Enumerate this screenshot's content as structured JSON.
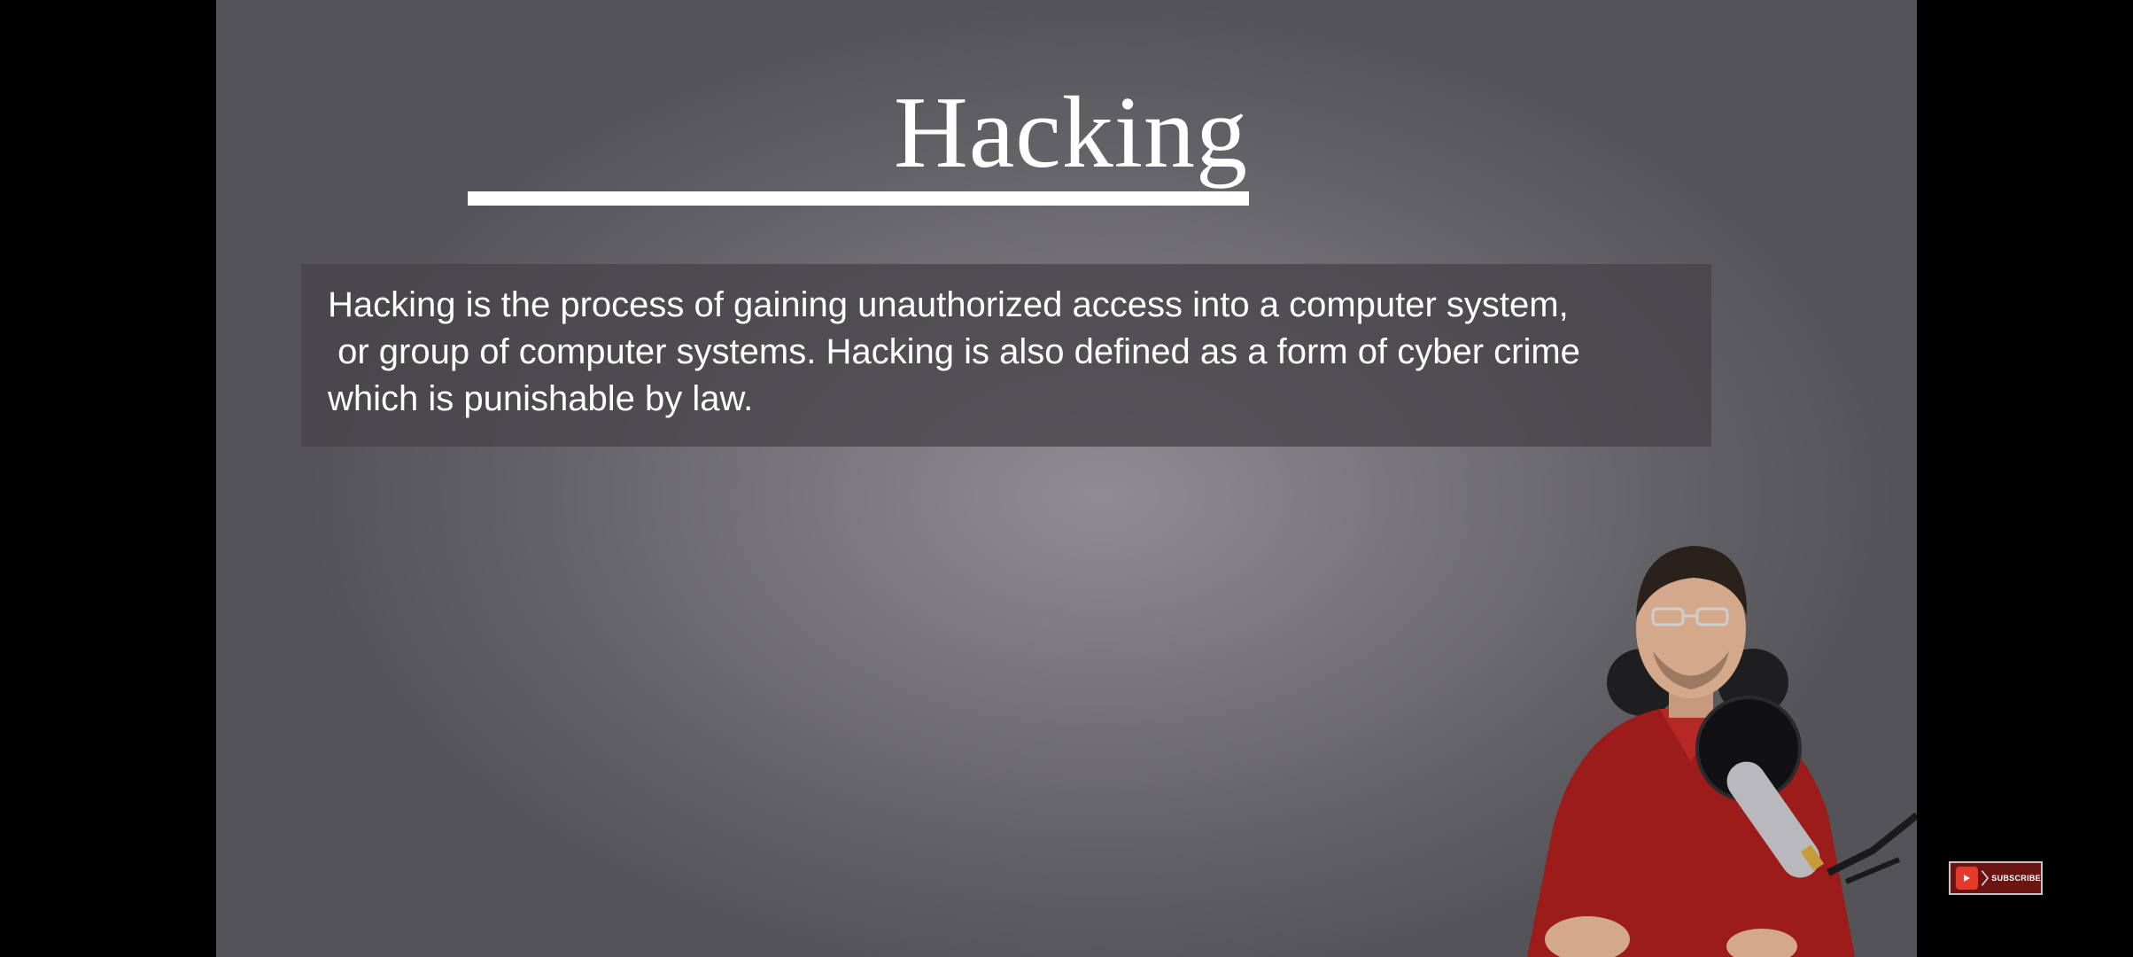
{
  "slide": {
    "title": "Hacking",
    "definition": "Hacking is the process of gaining unauthorized access into a computer system,\n or group of computer systems. Hacking is also defined as a form of cyber crime\nwhich is punishable by law."
  },
  "subscribe_button": {
    "label": "SUBSCRIBE"
  },
  "colors": {
    "background": "#000000",
    "slide_gray": "#6f6d72",
    "text": "#ffffff",
    "subscribe_red": "#6b1512"
  }
}
